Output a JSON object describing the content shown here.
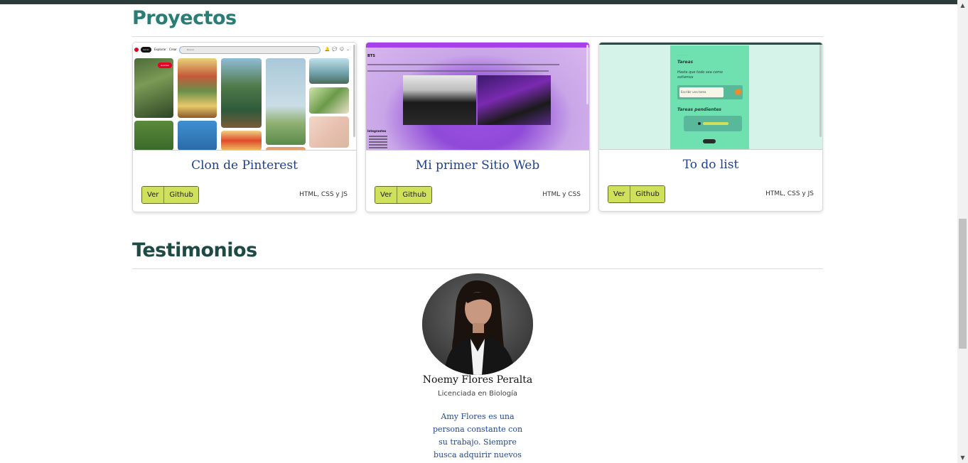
{
  "sections": {
    "projects_title": "Proyectos",
    "testimonials_title": "Testimonios"
  },
  "projects": [
    {
      "title": "Clon de Pinterest",
      "view_label": "Ver",
      "github_label": "Github",
      "tech": "HTML, CSS y JS",
      "preview": {
        "nav_home": "Inicio",
        "nav_explore": "Explorar",
        "nav_create": "Crear",
        "search_placeholder": "Buscar",
        "save_label": "Guardar"
      }
    },
    {
      "title": "Mi primer Sitio Web",
      "view_label": "Ver",
      "github_label": "Github",
      "tech": "HTML y CSS",
      "preview": {
        "heading": "BTS",
        "members_heading": "Integrantes"
      }
    },
    {
      "title": "To do list",
      "view_label": "Ver",
      "github_label": "Github",
      "tech": "HTML, CSS y JS",
      "preview": {
        "heading": "Tareas",
        "subheading": "Hasta que todo sea como soñamos",
        "input_placeholder": "Escribir una tarea",
        "pending_heading": "Tareas pendientes"
      }
    }
  ],
  "testimonial": {
    "name": "Noemy Flores Peralta",
    "role": "Licenciada en Biología",
    "quote": "Amy Flores es una persona constante con su trabajo. Siempre busca adquirir nuevos"
  },
  "colors": {
    "accent_teal": "#2a7d74",
    "title_blue": "#1f3f8f",
    "button_lime": "#cfe05a"
  }
}
